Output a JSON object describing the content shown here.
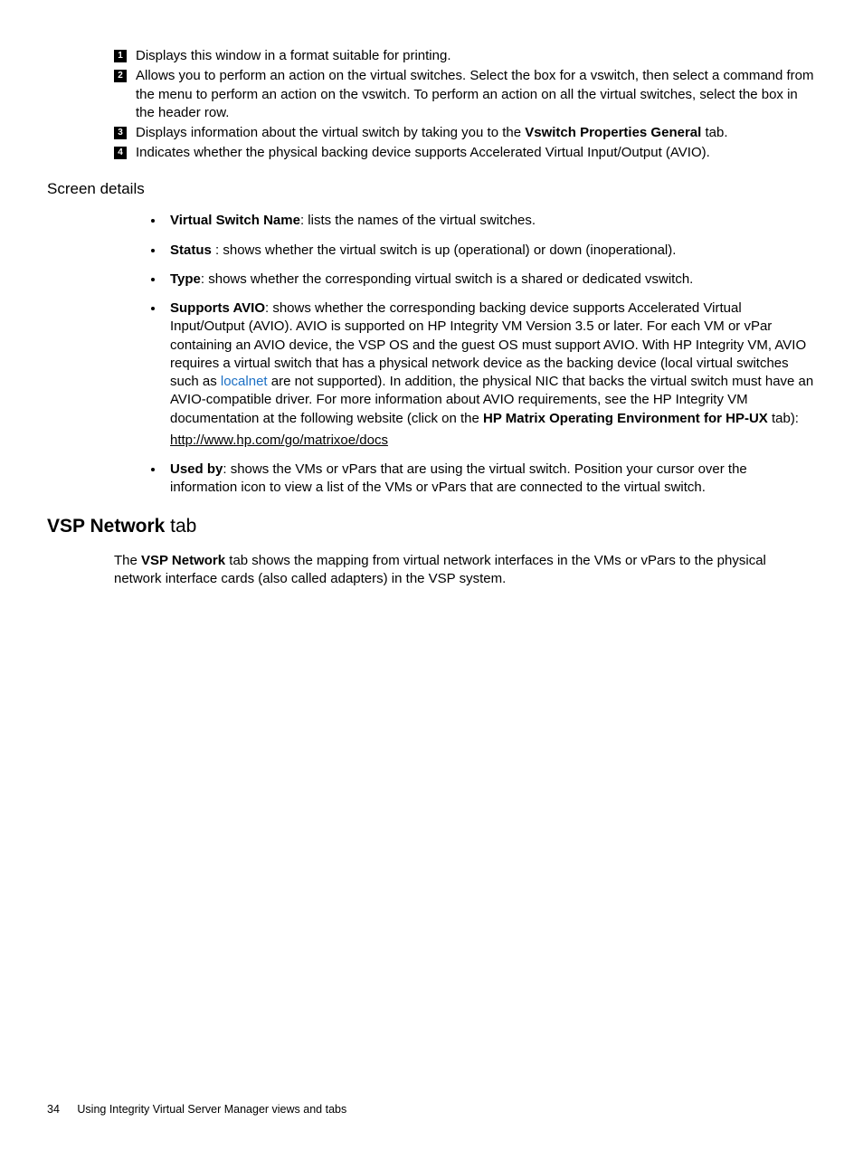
{
  "num_items": [
    {
      "n": "1",
      "html": "Displays this window in a format suitable for printing."
    },
    {
      "n": "2",
      "html": "Allows you to perform an action on the virtual switches. Select the box for a vswitch, then select a command from the menu to perform an action on the vswitch. To perform an action on all the virtual switches, select the box in the header row."
    },
    {
      "n": "3",
      "html": "Displays information about the virtual switch by taking you to the <b>Vswitch Properties General</b> tab."
    },
    {
      "n": "4",
      "html": "Indicates whether the physical backing device  supports Accelerated Virtual Input/Output (AVIO)."
    }
  ],
  "screen_details_heading": "Screen details",
  "bullets": [
    {
      "html": "<b>Virtual Switch Name</b>: lists the names of the virtual switches."
    },
    {
      "html": "<b>Status</b> : shows whether the virtual switch is up (operational) or down (inoperational)."
    },
    {
      "html": "<b>Type</b>: shows whether the corresponding virtual switch is a shared or dedicated vswitch."
    },
    {
      "html": "<b>Supports AVIO</b>: shows whether the corresponding backing device supports Accelerated Virtual Input/Output (AVIO). AVIO is supported on HP Integrity VM Version 3.5 or later. For each VM or vPar containing an AVIO device, the VSP OS and the guest OS must support AVIO. With HP Integrity VM, AVIO requires a virtual switch that has a physical network device as the backing device (local virtual switches such as <span class=\"link-blue\">localnet</span>  are not supported). In addition, the physical NIC that backs the virtual switch must have an AVIO-compatible driver.  For more information about AVIO requirements, see the HP Integrity VM documentation at the following website (click on the <b>HP Matrix Operating Environment for HP-UX</b> tab):",
      "link": "http://www.hp.com/go/matrixoe/docs"
    },
    {
      "html": "<b>Used by</b>: shows the VMs or vPars that are using the virtual switch. Position your cursor over the information icon to view a list of the VMs or vPars that are connected to the virtual switch."
    }
  ],
  "h2_bold": "VSP Network",
  "h2_rest": " tab",
  "section_para_html": "The <b>VSP Network</b> tab shows the mapping from virtual network interfaces in the VMs or vPars to the physical network interface cards (also called adapters) in the VSP system.",
  "footer_page": "34",
  "footer_text": "Using Integrity Virtual Server Manager views and tabs"
}
